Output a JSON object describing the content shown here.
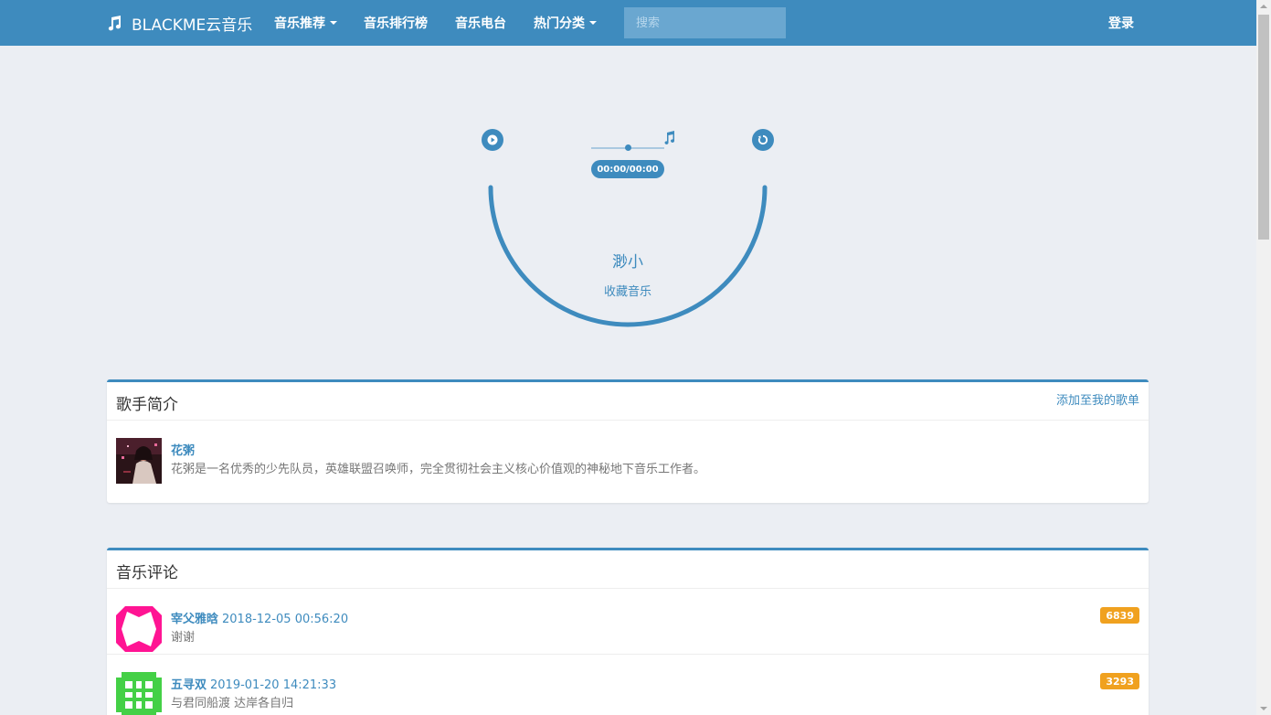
{
  "navbar": {
    "brand": "BLACKME云音乐",
    "items": [
      {
        "label": "音乐推荐",
        "dropdown": true
      },
      {
        "label": "音乐排行榜",
        "dropdown": false
      },
      {
        "label": "音乐电台",
        "dropdown": false
      },
      {
        "label": "热门分类",
        "dropdown": true
      }
    ],
    "search_placeholder": "搜索",
    "login": "登录"
  },
  "player": {
    "time": "00:00/00:00",
    "progress": 0.5,
    "song_title": "渺小",
    "favorite": "收藏音乐"
  },
  "artist_panel": {
    "title": "歌手简介",
    "add_link": "添加至我的歌单",
    "artist_name": "花粥",
    "artist_bio": "花粥是一名优秀的少先队员，英雄联盟召唤师，完全贯彻社会主义核心价值观的神秘地下音乐工作者。"
  },
  "comments_panel": {
    "title": "音乐评论",
    "comments": [
      {
        "user": "宰父雅晗",
        "date": "2018-12-05 00:56:20",
        "text": "谢谢",
        "likes": "6839"
      },
      {
        "user": "五寻双",
        "date": "2019-01-20 14:21:33",
        "text": "与君同船渡 达岸各自归",
        "likes": "3293"
      }
    ]
  },
  "colors": {
    "primary": "#3e8bbe",
    "background": "#ebeef3",
    "badge": "#f0a11f"
  }
}
